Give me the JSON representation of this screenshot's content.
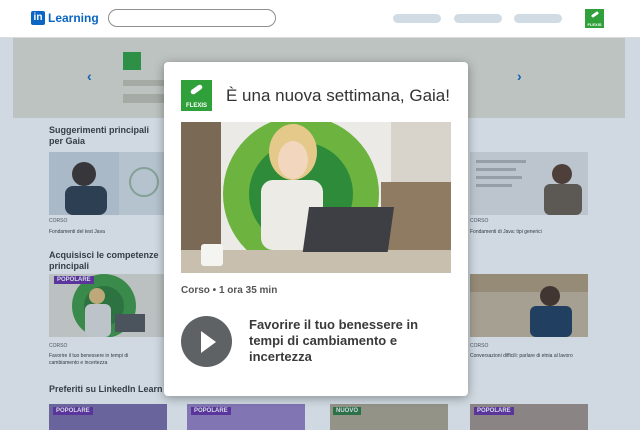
{
  "header": {
    "logo_mark": "in",
    "logo_text": "Learning",
    "search_placeholder": "",
    "flexis_label": "FLEXIS"
  },
  "banner": {
    "flexis_label": "FLEXIS"
  },
  "sections": [
    {
      "title": "Suggerimenti principali per Gaia",
      "cards": [
        {
          "kind": "CORSO",
          "title": "Fondamenti del test Java"
        },
        {
          "kind": "CORSO",
          "title": "Fondamenti di Java: tipi generici"
        }
      ]
    },
    {
      "title": "Acquisisci le competenze principali",
      "cards": [
        {
          "badge": "POPOLARE",
          "kind": "CORSO",
          "title": "Favorire il tuo benessere in tempi di cambiamento e incertezza"
        },
        {
          "kind": "CORSO",
          "title": "Conversazioni difficili: parlare di etnia al lavoro"
        }
      ]
    },
    {
      "title": "Preferiti su LinkedIn Learn",
      "cards": [
        {
          "badge": "POPOLARE"
        },
        {
          "badge": "POPOLARE"
        },
        {
          "badge": "NUOVO"
        },
        {
          "badge": "POPOLARE"
        }
      ]
    }
  ],
  "modal": {
    "flexis_label": "FLEXIS",
    "title": "È una nuova settimana, Gaia!",
    "meta": "Corso • 1 ora 35 min",
    "course_title": "Favorire il tuo benessere in tempi di cambiamento e incertezza"
  },
  "colors": {
    "brand_blue": "#0a66c2",
    "flexis_green": "#30a13a",
    "badge_purple": "#6a2ea6",
    "badge_green": "#2d7a3a"
  }
}
